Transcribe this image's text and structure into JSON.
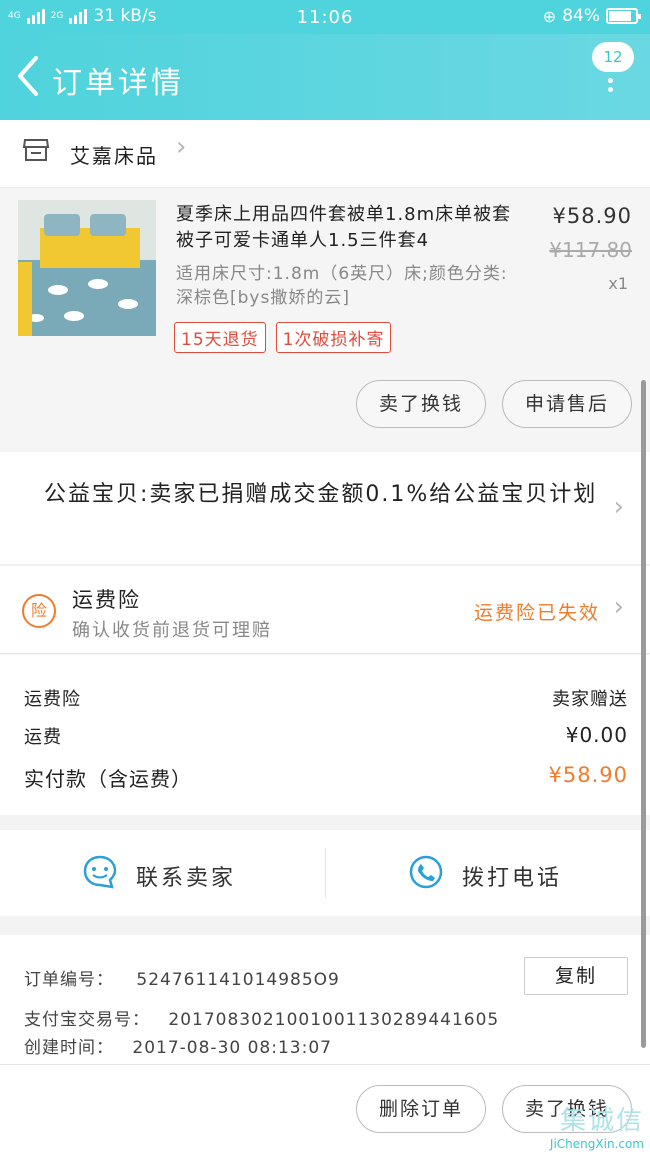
{
  "status_bar": {
    "network_left": "4G",
    "network_right": "2G",
    "speed": "31 kB/s",
    "time": "11:06",
    "battery": "84%",
    "battery_level": 0.84
  },
  "header": {
    "title": "订单详情",
    "badge": "12"
  },
  "shop": {
    "name": "艾嘉床品"
  },
  "item": {
    "title": "夏季床上用品四件套被单1.8m床单被套被子可爱卡通单人1.5三件套4",
    "sku": "适用床尺寸:1.8m（6英尺）床;颜色分类:深棕色[bys撒娇的云]",
    "price": "¥58.90",
    "original_price": "¥117.80",
    "quantity": "x1",
    "tags": [
      "15天退货",
      "1次破损补寄"
    ],
    "buttons": {
      "sell_for_cash": "卖了换钱",
      "after_sales": "申请售后"
    }
  },
  "charity": {
    "text": "公益宝贝:卖家已捐赠成交金额0.1%给公益宝贝计划"
  },
  "insurance": {
    "icon_char": "险",
    "title": "运费险",
    "desc": "确认收货前退货可理赔",
    "status": "运费险已失效"
  },
  "totals": {
    "insurance_label": "运费险",
    "insurance_value": "卖家赠送",
    "shipping_label": "运费",
    "shipping_value": "¥0.00",
    "paid_label": "实付款（含运费）",
    "paid_value": "¥58.90"
  },
  "contact": {
    "seller": "联系卖家",
    "phone": "拨打电话"
  },
  "order_info": {
    "order_no_label": "订单编号：",
    "order_no": "524761141014985O9",
    "alipay_label": "支付宝交易号：",
    "alipay_no": "2017083021001001130289441605",
    "created_label": "创建时间：",
    "created_value": "2017-08-30 08:13:07",
    "copy": "复制"
  },
  "bottom": {
    "delete_order": "删除订单",
    "sell_for_cash": "卖了换钱"
  },
  "watermark": {
    "cn": "集诚信",
    "en": "JiChengXin.com"
  },
  "colors": {
    "accent": "#4fd3dc",
    "warning": "#f07c2b",
    "tag": "#e24a3b"
  }
}
